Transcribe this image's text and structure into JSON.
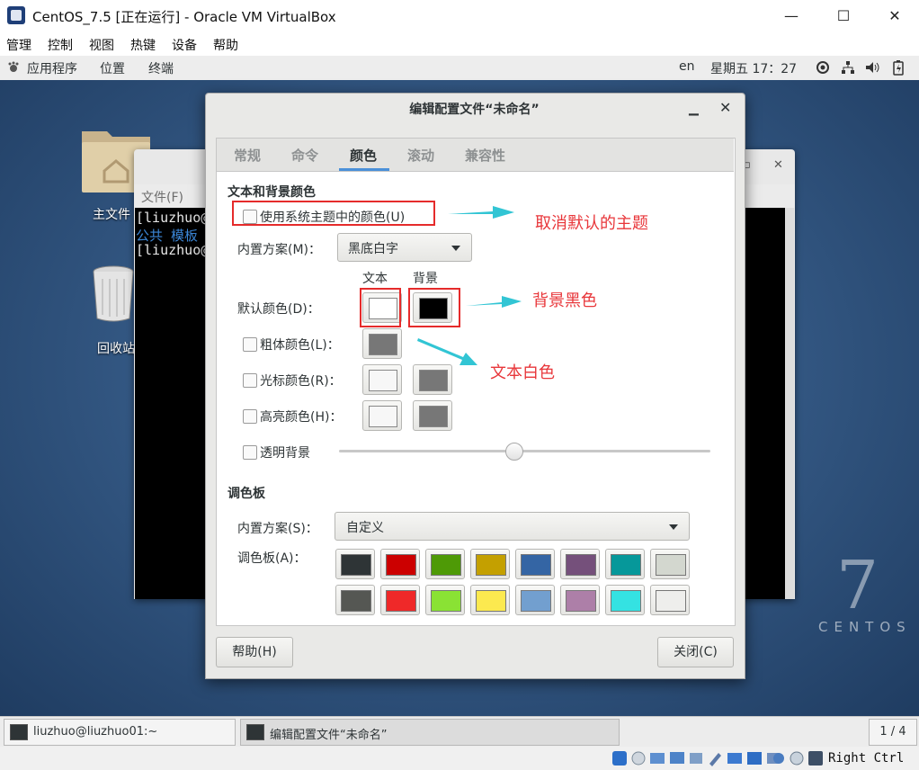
{
  "vbox": {
    "title": "CentOS_7.5 [正在运行] - Oracle VM VirtualBox",
    "menu": [
      "管理",
      "控制",
      "视图",
      "热键",
      "设备",
      "帮助"
    ],
    "controls": {
      "minimize": "—",
      "maximize": "☐",
      "close": "✕"
    }
  },
  "gnome": {
    "apps": "应用程序",
    "places": "位置",
    "terminal": "终端",
    "lang": "en",
    "clock": "星期五 17：27"
  },
  "desktop": {
    "folder_label": "主文件",
    "trash_label": "回收站",
    "centos_seven": "7",
    "centos_word": "CENTOS"
  },
  "terminal": {
    "menu_file": "文件(F)",
    "lines": [
      "[liuzhuo@",
      "公共   模板",
      "[liuzhuo@"
    ]
  },
  "dialog": {
    "title": "编辑配置文件“未命名”",
    "tabs": [
      "常规",
      "命令",
      "颜色",
      "滚动",
      "兼容性"
    ],
    "active_tab": "颜色",
    "text_bg_section": "文本和背景颜色",
    "use_system_theme": "使用系统主题中的颜色(U)",
    "builtin_scheme_label": "内置方案(M)：",
    "builtin_scheme_value": "黑底白字",
    "col_text": "文本",
    "col_bg": "背景",
    "default_color_label": "默认颜色(D)：",
    "bold_color_label": "粗体颜色(L)：",
    "cursor_color_label": "光标颜色(R)：",
    "highlight_color_label": "高亮颜色(H)：",
    "transparent_label": "透明背景",
    "transparency_level": 0.47,
    "palette_section": "调色板",
    "palette_scheme_label": "内置方案(S)：",
    "palette_scheme_value": "自定义",
    "palette_label": "调色板(A)：",
    "help_button": "帮助(H)",
    "close_button": "关闭(C)",
    "colors": {
      "default_text": "#ffffff",
      "default_bg": "#000000",
      "bold": "#777777",
      "cursor_text": "#f7f7f7",
      "cursor_bg": "#777777",
      "highlight_text": "#f7f7f7",
      "highlight_bg": "#777777"
    },
    "palette_row1": [
      "#2e3436",
      "#cc0000",
      "#4e9a06",
      "#c4a000",
      "#3465a4",
      "#75507b",
      "#06989a",
      "#d3d7cf"
    ],
    "palette_row2": [
      "#555753",
      "#ef2929",
      "#8ae234",
      "#fce94f",
      "#729fcf",
      "#ad7fa8",
      "#34e2e2",
      "#eeeeec"
    ]
  },
  "annotations": {
    "uncheck_theme": "取消默认的主题",
    "bg_black": "背景黑色",
    "text_white": "文本白色",
    "arrow_color": "#32c5d4"
  },
  "taskbar": {
    "task1": "liuzhuo@liuzhuo01:~",
    "task2": "编辑配置文件“未命名”",
    "workspace": "1 / 4"
  },
  "vb_status": {
    "host_key": "Right Ctrl"
  }
}
